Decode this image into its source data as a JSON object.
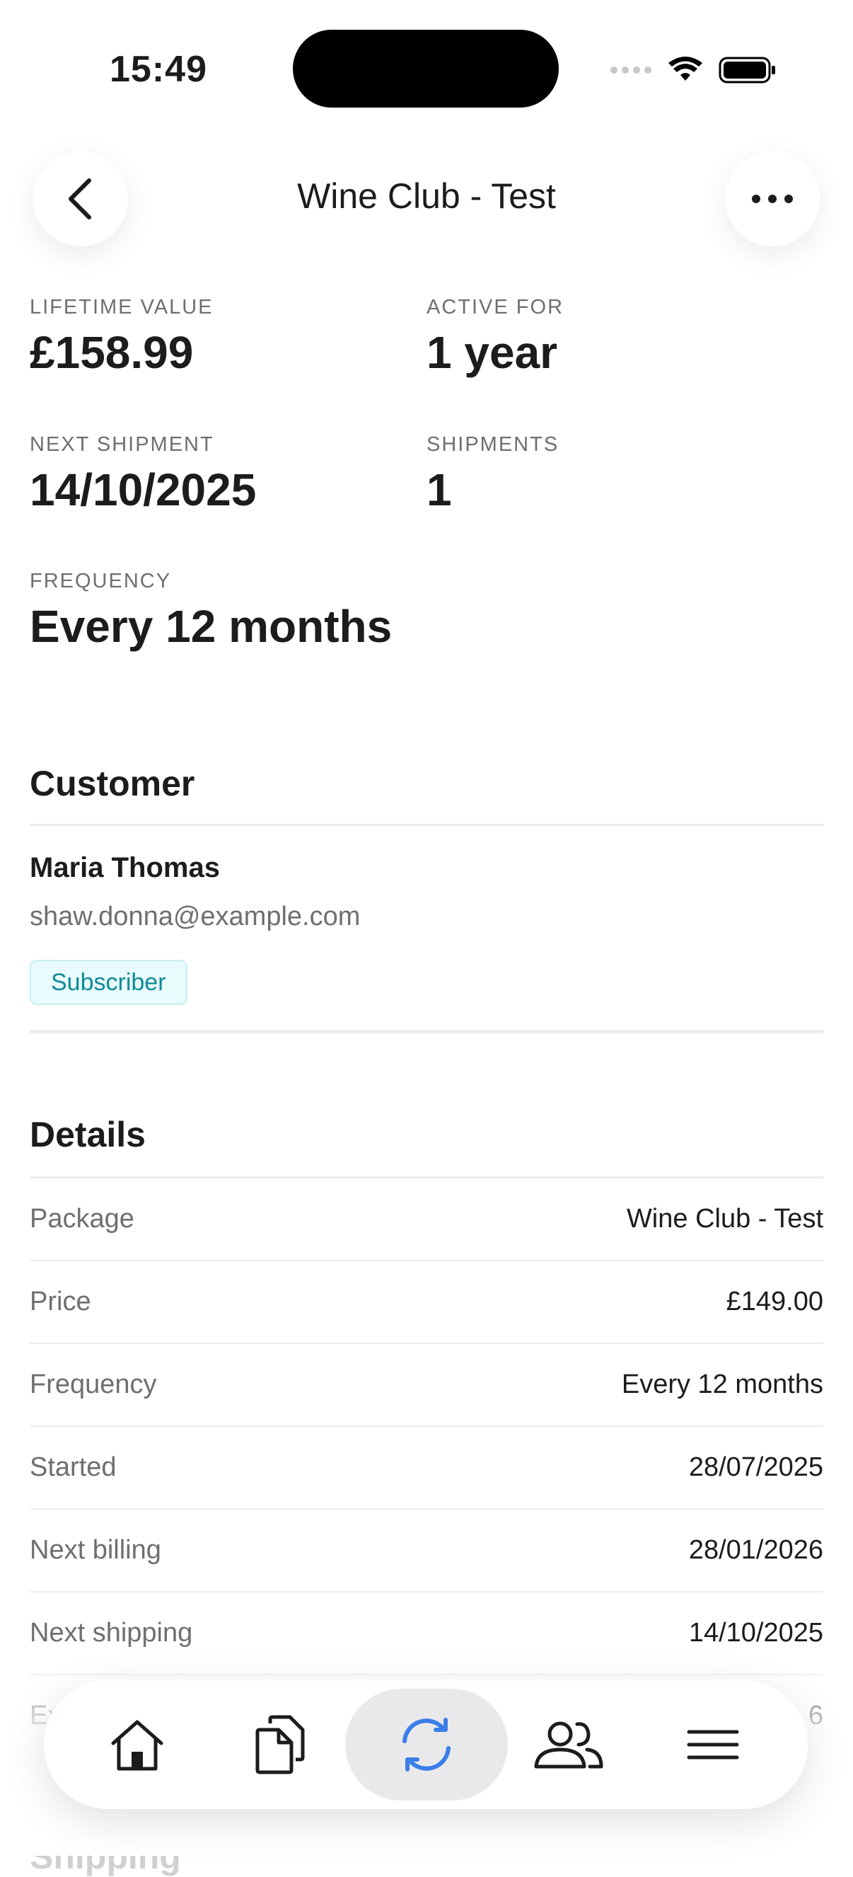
{
  "status_bar": {
    "time": "15:49"
  },
  "header": {
    "title": "Wine Club - Test"
  },
  "stats": [
    {
      "label": "LIFETIME VALUE",
      "value": "£158.99"
    },
    {
      "label": "ACTIVE FOR",
      "value": "1 year"
    },
    {
      "label": "NEXT SHIPMENT",
      "value": "14/10/2025"
    },
    {
      "label": "SHIPMENTS",
      "value": "1"
    },
    {
      "label": "FREQUENCY",
      "value": "Every 12 months"
    }
  ],
  "customer": {
    "section_title": "Customer",
    "name": "Maria Thomas",
    "email": "shaw.donna@example.com",
    "badge": "Subscriber"
  },
  "details": {
    "section_title": "Details",
    "rows": [
      {
        "label": "Package",
        "value": "Wine Club - Test"
      },
      {
        "label": "Price",
        "value": "£149.00"
      },
      {
        "label": "Frequency",
        "value": "Every 12 months"
      },
      {
        "label": "Started",
        "value": "28/07/2025"
      },
      {
        "label": "Next billing",
        "value": "28/01/2026"
      },
      {
        "label": "Next shipping",
        "value": "14/10/2025"
      },
      {
        "label": "Ex",
        "value": "6"
      }
    ]
  },
  "next_section": {
    "title": "Shipping"
  },
  "tabbar": {
    "items": [
      {
        "icon": "home-icon",
        "active": false
      },
      {
        "icon": "documents-icon",
        "active": false
      },
      {
        "icon": "sync-icon",
        "active": true
      },
      {
        "icon": "users-icon",
        "active": false
      },
      {
        "icon": "menu-icon",
        "active": false
      }
    ],
    "active_color": "#3a7ee8"
  }
}
